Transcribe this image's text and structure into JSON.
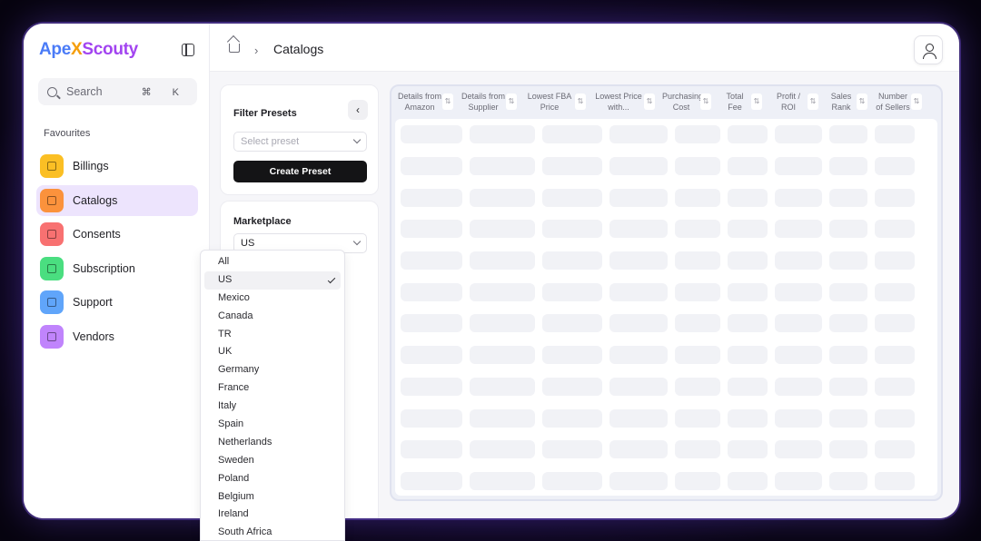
{
  "app": {
    "logo_part1": "Ape",
    "logo_x": "X",
    "logo_part2": "Scouty"
  },
  "sidebar": {
    "search_placeholder": "Search",
    "search_shortcut": "⌘ K",
    "section_label": "Favourites",
    "items": [
      {
        "label": "Billings",
        "icon": "billing-icon",
        "color": "#fbbf24",
        "active": false
      },
      {
        "label": "Catalogs",
        "icon": "calendar-icon",
        "color": "#fb923c",
        "active": true
      },
      {
        "label": "Consents",
        "icon": "plug-icon",
        "color": "#f87171",
        "active": false
      },
      {
        "label": "Subscription",
        "icon": "plug-icon",
        "color": "#4ade80",
        "active": false
      },
      {
        "label": "Support",
        "icon": "headset-icon",
        "color": "#60a5fa",
        "active": false
      },
      {
        "label": "Vendors",
        "icon": "store-icon",
        "color": "#c084fc",
        "active": false
      }
    ]
  },
  "topbar": {
    "breadcrumb_current": "Catalogs"
  },
  "filter_presets": {
    "title": "Filter Presets",
    "select_placeholder": "Select preset",
    "create_button": "Create Preset"
  },
  "marketplace": {
    "title": "Marketplace",
    "selected": "US",
    "options": [
      "All",
      "US",
      "Mexico",
      "Canada",
      "TR",
      "UK",
      "Germany",
      "France",
      "Italy",
      "Spain",
      "Netherlands",
      "Sweden",
      "Poland",
      "Belgium",
      "Ireland",
      "South Africa"
    ]
  },
  "table": {
    "columns": [
      "Details from Amazon",
      "Details from Supplier",
      "Lowest FBA Price",
      "Lowest Price with...",
      "Purchasing Cost",
      "Total Fee",
      "Profit / ROI",
      "Sales Rank",
      "Number of Sellers"
    ]
  }
}
